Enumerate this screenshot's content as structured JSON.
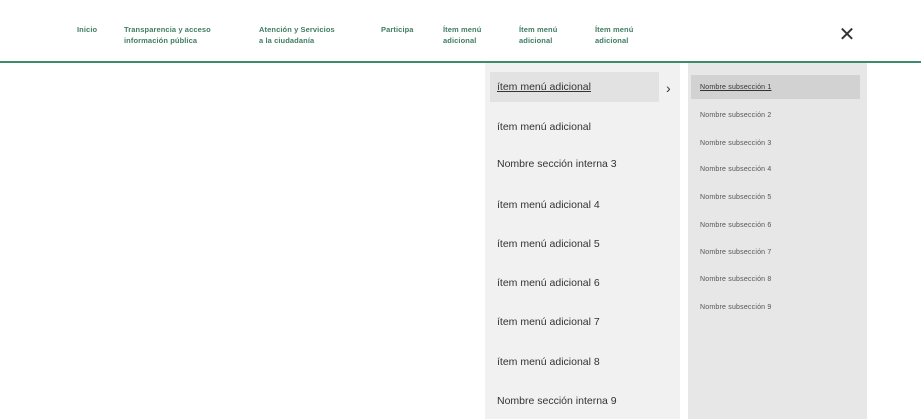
{
  "nav": {
    "items": [
      {
        "label": "Inicio"
      },
      {
        "label": "Transparencia y acceso\ninformación pública"
      },
      {
        "label": "Atención y Servicios\na la ciudadanía"
      },
      {
        "label": "Participa"
      },
      {
        "label": "Ítem menú\nadicional"
      },
      {
        "label": "Ítem menú\nadicional"
      },
      {
        "label": "Ítem menú\nadicional"
      }
    ],
    "close_symbol": "✕"
  },
  "menu": {
    "chevron": "›",
    "items": [
      {
        "label": "ítem menú adicional"
      },
      {
        "label": "ítem menú adicional"
      },
      {
        "label": "Nombre sección interna 3"
      },
      {
        "label": "ítem menú adicional 4"
      },
      {
        "label": "ítem menú adicional 5"
      },
      {
        "label": "ítem menú adicional 6"
      },
      {
        "label": "ítem menú adicional 7"
      },
      {
        "label": "ítem menú adicional 8"
      },
      {
        "label": "Nombre sección interna 9"
      }
    ]
  },
  "submenu": {
    "items": [
      {
        "label": "Nombre subsección 1"
      },
      {
        "label": "Nombre subsección 2"
      },
      {
        "label": "Nombre subsección 3"
      },
      {
        "label": "Nombre subsección 4"
      },
      {
        "label": "Nombre subsección 5"
      },
      {
        "label": "Nombre subsección 6"
      },
      {
        "label": "Nombre subsección 7"
      },
      {
        "label": "Nombre subsección 8"
      },
      {
        "label": "Nombre subsección 9"
      }
    ]
  },
  "colors": {
    "accent": "#3d8b6a",
    "nav_text": "#3f7d62"
  }
}
